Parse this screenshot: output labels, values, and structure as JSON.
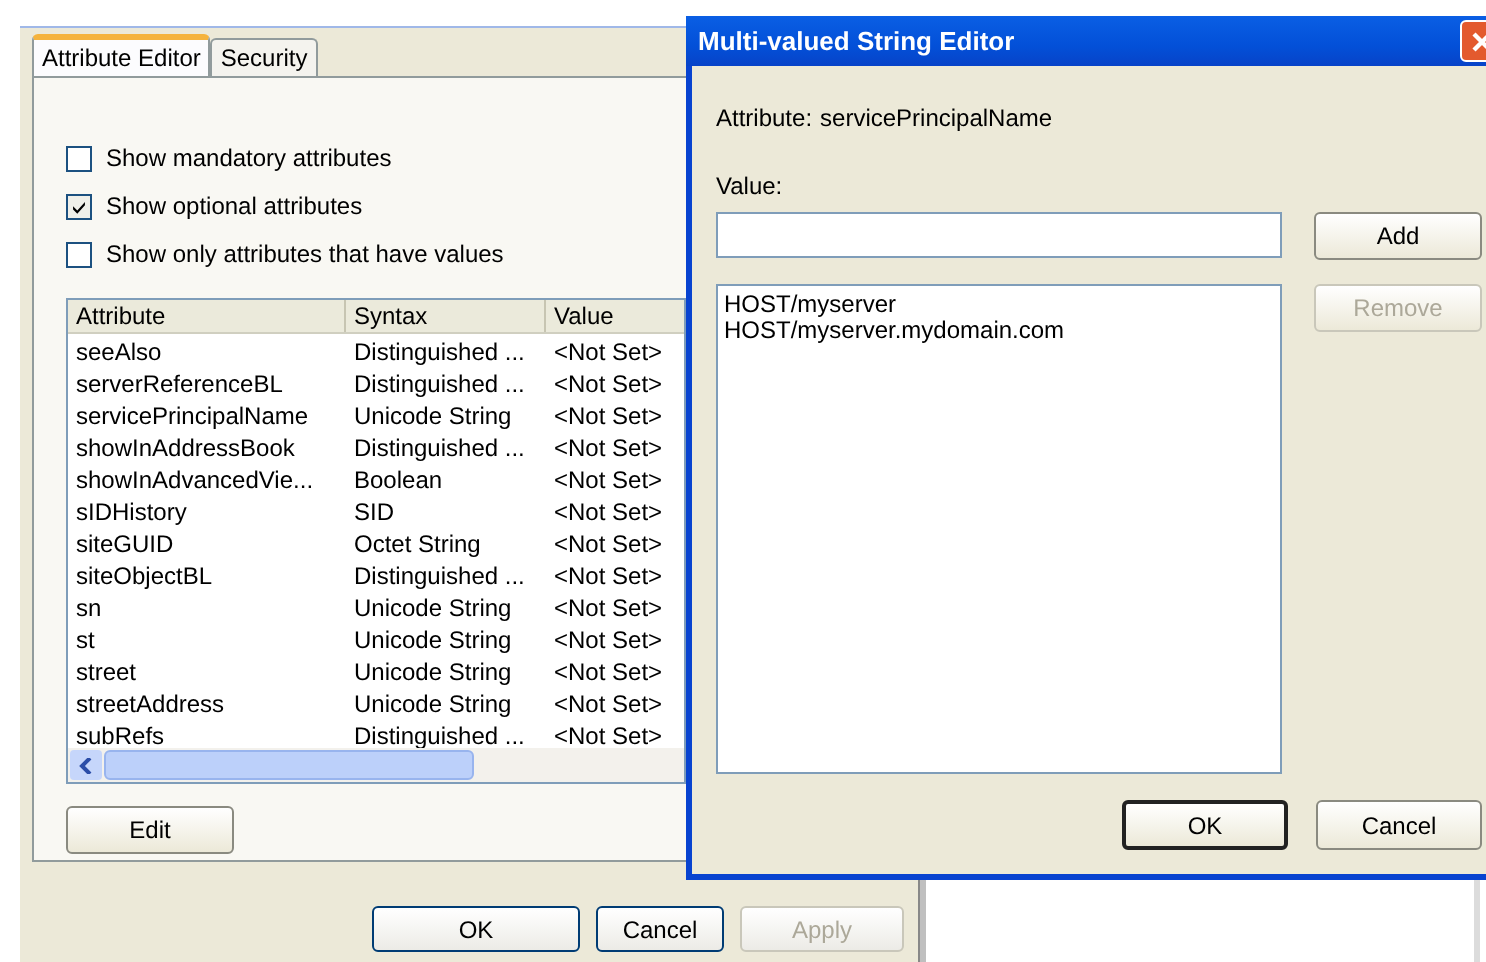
{
  "background_dialog": {
    "tabs": [
      {
        "label": "Attribute Editor",
        "selected": true
      },
      {
        "label": "Security",
        "selected": false
      }
    ],
    "options": [
      {
        "label": "Show mandatory attributes",
        "checked": false
      },
      {
        "label": "Show optional attributes",
        "checked": true
      },
      {
        "label": "Show only attributes that have values",
        "checked": false
      }
    ],
    "table": {
      "columns": [
        "Attribute",
        "Syntax",
        "Value"
      ],
      "rows": [
        [
          "seeAlso",
          "Distinguished ...",
          "<Not Set>"
        ],
        [
          "serverReferenceBL",
          "Distinguished ...",
          "<Not Set>"
        ],
        [
          "servicePrincipalName",
          "Unicode String",
          "<Not Set>"
        ],
        [
          "showInAddressBook",
          "Distinguished ...",
          "<Not Set>"
        ],
        [
          "showInAdvancedVie...",
          "Boolean",
          "<Not Set>"
        ],
        [
          "sIDHistory",
          "SID",
          "<Not Set>"
        ],
        [
          "siteGUID",
          "Octet String",
          "<Not Set>"
        ],
        [
          "siteObjectBL",
          "Distinguished ...",
          "<Not Set>"
        ],
        [
          "sn",
          "Unicode String",
          "<Not Set>"
        ],
        [
          "st",
          "Unicode String",
          "<Not Set>"
        ],
        [
          "street",
          "Unicode String",
          "<Not Set>"
        ],
        [
          "streetAddress",
          "Unicode String",
          "<Not Set>"
        ],
        [
          "subRefs",
          "Distinguished ...",
          "<Not Set>"
        ]
      ]
    },
    "edit_button": "Edit",
    "buttons": [
      {
        "label": "OK",
        "disabled": false
      },
      {
        "label": "Cancel",
        "disabled": false
      },
      {
        "label": "Apply",
        "disabled": true
      }
    ]
  },
  "editor_dialog": {
    "title": "Multi-valued String Editor",
    "attribute_label": "Attribute:",
    "attribute_value": "servicePrincipalName",
    "value_label": "Value:",
    "values": [
      "HOST/myserver",
      "HOST/myserver.mydomain.com"
    ],
    "side_buttons": [
      {
        "label": "Add",
        "disabled": false
      },
      {
        "label": "Remove",
        "disabled": true
      }
    ],
    "buttons": [
      {
        "label": "OK",
        "default": true
      },
      {
        "label": "Cancel",
        "default": false
      }
    ]
  }
}
